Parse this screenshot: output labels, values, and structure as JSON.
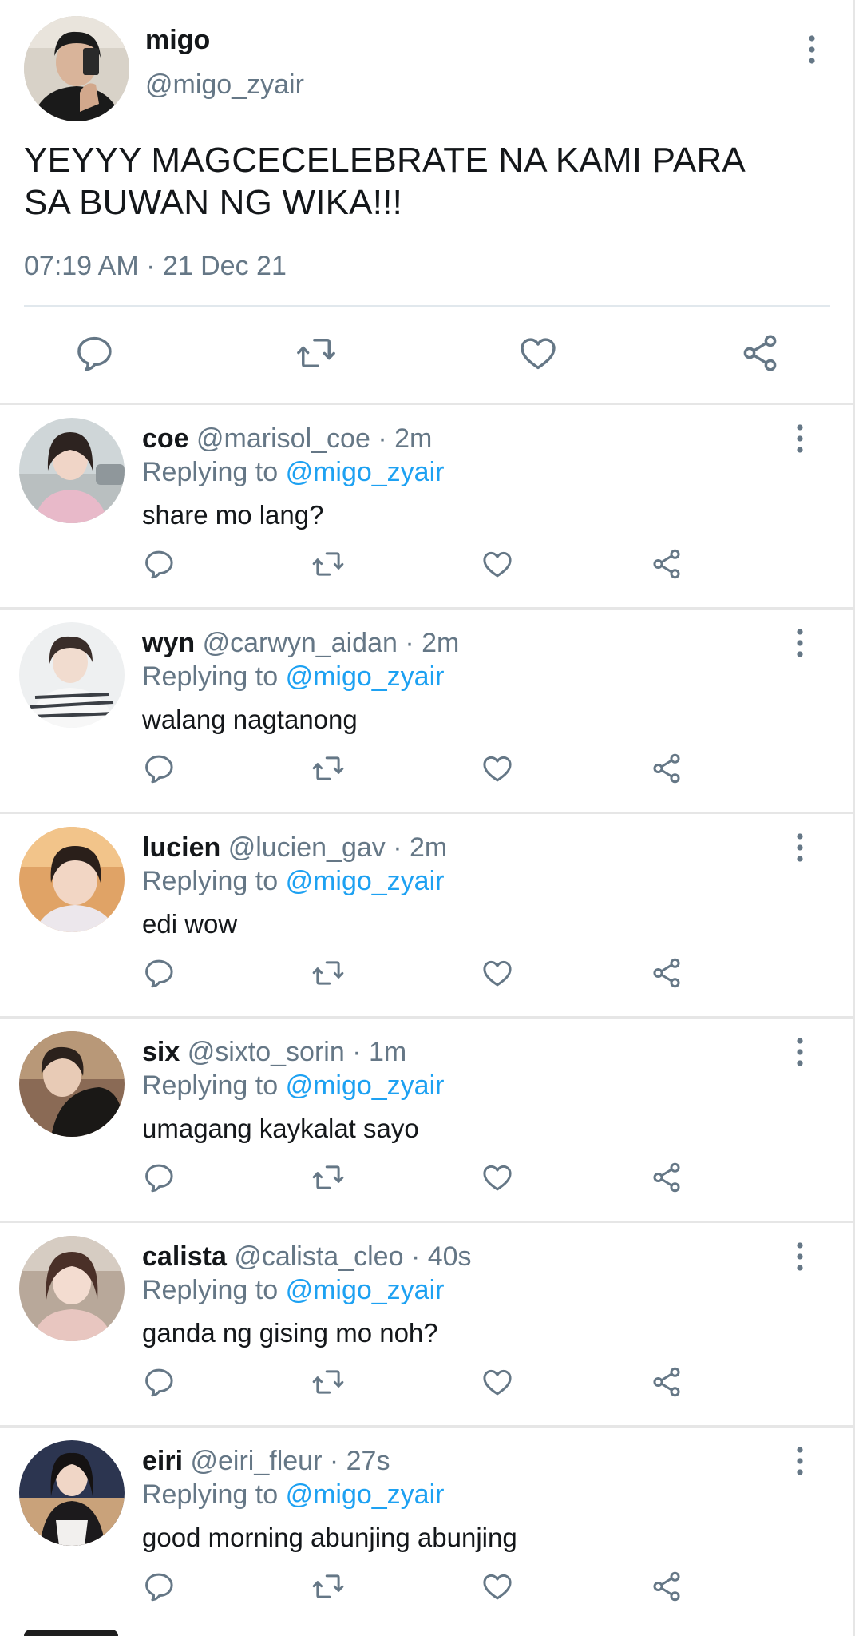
{
  "tweet": {
    "name": "migo",
    "handle": "@migo_zyair",
    "text": "YEYYY MAGCECELEBRATE NA KAMI PARA SA BUWAN NG WIKA!!!",
    "timestamp": "07:19 AM · 21 Dec 21"
  },
  "replying_prefix": "Replying to",
  "replies": [
    {
      "name": "coe",
      "handle": "@marisol_coe",
      "time": "· 2m",
      "mention": "@migo_zyair",
      "text": "share mo lang?"
    },
    {
      "name": "wyn",
      "handle": "@carwyn_aidan",
      "time": "· 2m",
      "mention": "@migo_zyair",
      "text": "walang nagtanong"
    },
    {
      "name": "lucien",
      "handle": "@lucien_gav",
      "time": "· 2m",
      "mention": "@migo_zyair",
      "text": "edi wow"
    },
    {
      "name": "six",
      "handle": "@sixto_sorin",
      "time": "· 1m",
      "mention": "@migo_zyair",
      "text": "umagang kaykalat sayo"
    },
    {
      "name": "calista",
      "handle": "@calista_cleo",
      "time": "· 40s",
      "mention": "@migo_zyair",
      "text": "ganda ng gising mo noh?"
    },
    {
      "name": "eiri",
      "handle": "@eiri_fleur",
      "time": "· 27s",
      "mention": "@migo_zyair",
      "text": "good morning abunjing abunjing"
    }
  ],
  "icons": {
    "reply": "speech-bubble-icon",
    "retweet": "retweet-arrows-icon",
    "like": "heart-outline-icon",
    "share": "share-nodes-icon",
    "more": "vertical-dots-icon"
  },
  "colors": {
    "text": "#14171a",
    "secondary": "#657786",
    "link": "#1da1f2",
    "divider": "#e6e6e6"
  }
}
